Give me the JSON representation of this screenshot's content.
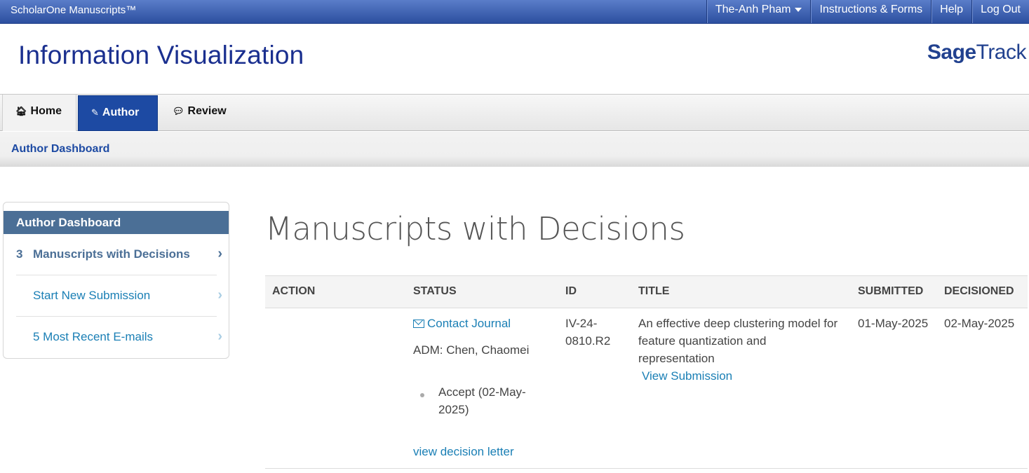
{
  "topbar": {
    "brand": "ScholarOne Manuscripts™",
    "user": "The-Anh Pham",
    "instructions": "Instructions & Forms",
    "help": "Help",
    "logout": "Log Out"
  },
  "header": {
    "journal_title": "Information Visualization",
    "logo_sage": "Sage",
    "logo_track": "Track"
  },
  "tabs": {
    "home": "Home",
    "author": "Author",
    "review": "Review"
  },
  "breadcrumb": "Author Dashboard",
  "sidebar": {
    "header": "Author Dashboard",
    "items": [
      {
        "count": "3",
        "label": "Manuscripts with Decisions"
      },
      {
        "count": "",
        "label": "Start New Submission"
      },
      {
        "count": "",
        "label": "5 Most Recent E-mails"
      }
    ]
  },
  "main": {
    "title": "Manuscripts with Decisions",
    "columns": [
      "ACTION",
      "STATUS",
      "ID",
      "TITLE",
      "SUBMITTED",
      "DECISIONED"
    ],
    "rows": [
      {
        "contact_journal": "Contact Journal",
        "adm": "ADM: Chen, Chaomei",
        "decision_line1": "Accept (02-May-",
        "decision_line2": "2025)",
        "decision_letter": "view decision letter",
        "id_line1": "IV-24-",
        "id_line2": "0810.R2",
        "title_line1": "An effective deep clustering model for",
        "title_line2": "feature quantization and",
        "title_line3": "representation",
        "view_submission": "View Submission",
        "submitted": "01-May-2025",
        "decisioned": "02-May-2025"
      }
    ]
  },
  "colors": {
    "accent": "#1d4aa3",
    "link": "#1a7fb5",
    "sidebar_header": "#4b6f96"
  }
}
